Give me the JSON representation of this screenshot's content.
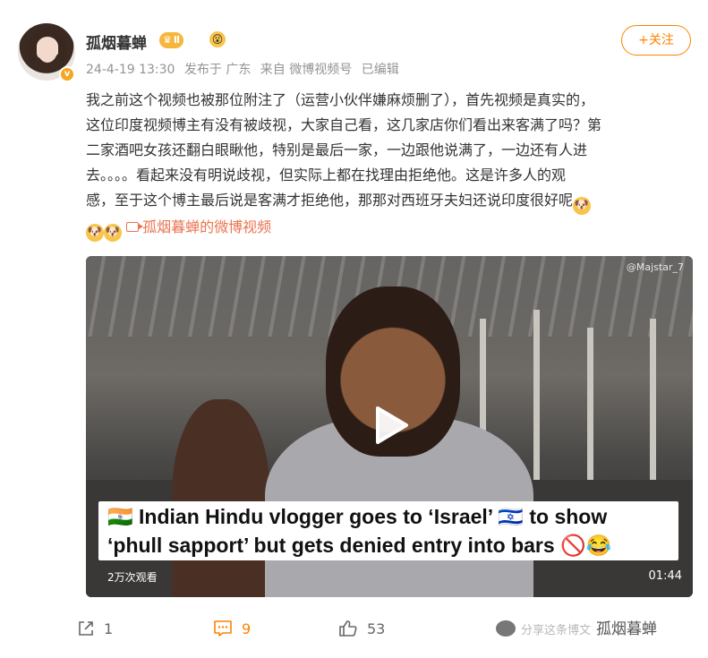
{
  "user": {
    "name": "孤烟暮蝉",
    "level_badge": "Ⅱ",
    "verified_mark": "v",
    "avatar_icon": "avatar"
  },
  "meta": {
    "time": "24-4-19 13:30",
    "location": "发布于 广东",
    "source": "来自 微博视频号",
    "edited": "已编辑"
  },
  "follow": {
    "label": "+关注"
  },
  "post": {
    "lines": [
      "我之前这个视频也被那位附注了（运营小伙伴嫌麻烦删了），首先视频是真实的，",
      "这位印度视频博主有没有被歧视，大家自己看，这几家店你们看出来客满了吗？第",
      "二家酒吧女孩还翻白眼瞅他，特别是最后一家，一边跟他说满了，一边还有人进",
      "去。。。。看起来没有明说歧视，但实际上都在找理由拒绝他。这是许多人的观",
      "感，至于这个博主最后说是客满才拒绝他，那那对西班牙夫妇还说印度很好呢"
    ],
    "video_link": "孤烟暮蝉的微博视频"
  },
  "video": {
    "watermark": "@Majstar_7",
    "caption_line1": "🇮🇳 Indian Hindu vlogger goes to ‘Israel’ 🇮🇱 to show",
    "caption_line2": "‘phull sapport’ but gets denied entry into bars 🚫😂",
    "views": "2万次观看",
    "duration": "01:44"
  },
  "actions": {
    "share_count": "1",
    "comment_count": "9",
    "like_count": "53"
  },
  "wechat_watermark": {
    "faded_text": "分享这条博文",
    "account": "孤烟暮蝉"
  },
  "colors": {
    "accent": "#ff8200",
    "link": "#eb7350",
    "meta": "#939393"
  }
}
